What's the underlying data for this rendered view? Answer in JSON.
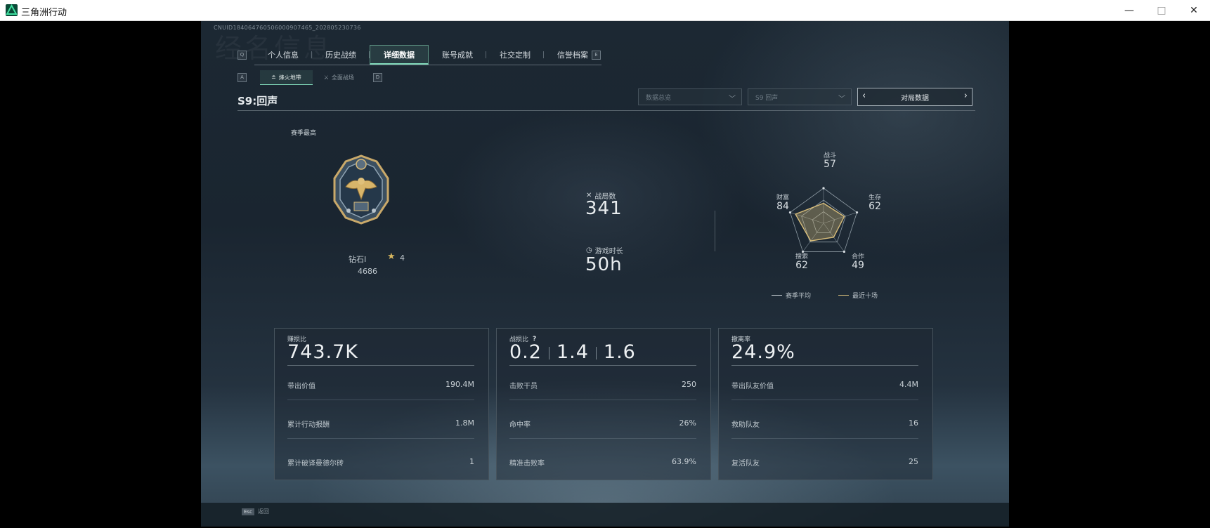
{
  "window": {
    "title": "三角洲行动",
    "minimize": "—",
    "maximize": "□",
    "close": "✕"
  },
  "uid": "CNUID184064760506000907465_202805230736",
  "ghost_title": "经名信息",
  "tab_keys": {
    "left": "Q",
    "right": "E"
  },
  "tabs": [
    {
      "label": "个人信息"
    },
    {
      "label": "历史战绩"
    },
    {
      "label": "详细数据",
      "active": true
    },
    {
      "label": "账号成就"
    },
    {
      "label": "社交定制"
    },
    {
      "label": "信誉档案"
    }
  ],
  "subtab_keys": {
    "left": "A",
    "right": "D"
  },
  "subtabs": [
    {
      "label": "烽火地带",
      "active": true
    },
    {
      "label": "全面战场"
    }
  ],
  "season_title": "S9:回声",
  "filters": {
    "data_scope": "数据总览",
    "season": "S9 回声",
    "match_data": "对局数据"
  },
  "rank": {
    "section_label": "赛季最高",
    "name": "钻石Ⅰ",
    "stars": "4",
    "score": "4686"
  },
  "stats": {
    "matches_label": "战局数",
    "matches_value": "341",
    "time_label": "游戏时长",
    "time_value": "50h"
  },
  "radar": {
    "labels": {
      "combat": "战斗",
      "survival": "生存",
      "cooperation": "合作",
      "search": "搜索",
      "wealth": "财富"
    },
    "values": {
      "combat": "57",
      "survival": "62",
      "cooperation": "49",
      "search": "62",
      "wealth": "84"
    },
    "legend": {
      "season_avg": "赛季平均",
      "recent_ten": "最近十场"
    },
    "colors": {
      "season_avg": "#c8cfd4",
      "recent_ten": "#d8bd7a"
    }
  },
  "panels": {
    "profit": {
      "title": "赚损比",
      "value": "743.7K",
      "rows": [
        {
          "label": "带出价值",
          "value": "190.4M"
        },
        {
          "label": "累计行动报酬",
          "value": "1.8M"
        },
        {
          "label": "累计破译曼德尔砖",
          "value": "1"
        }
      ]
    },
    "kd": {
      "title": "战损比",
      "help": "?",
      "values": [
        "0.2",
        "1.4",
        "1.6"
      ],
      "rows": [
        {
          "label": "击败干员",
          "value": "250"
        },
        {
          "label": "命中率",
          "value": "26%"
        },
        {
          "label": "精准击败率",
          "value": "63.9%"
        }
      ]
    },
    "extract": {
      "title": "撤离率",
      "value": "24.9%",
      "rows": [
        {
          "label": "带出队友价值",
          "value": "4.4M"
        },
        {
          "label": "救助队友",
          "value": "16"
        },
        {
          "label": "复活队友",
          "value": "25"
        }
      ]
    }
  },
  "bottom": {
    "esc_key": "Esc",
    "esc_label": "返回"
  }
}
